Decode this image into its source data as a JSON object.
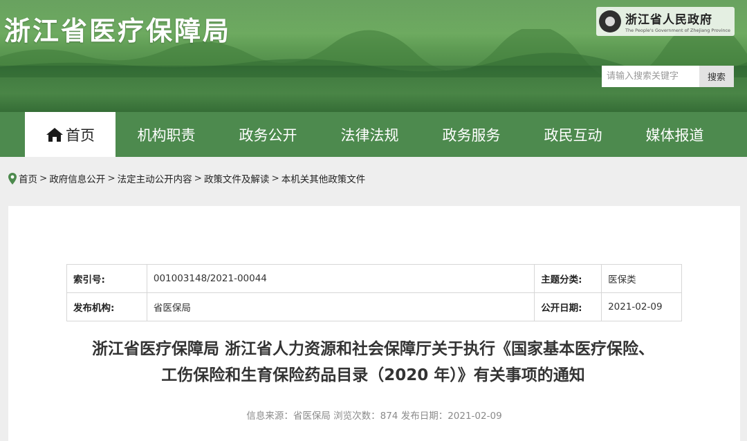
{
  "header": {
    "site_title": "浙江省医疗保障局",
    "gov_name_cn": "浙江省人民政府",
    "gov_name_en": "The People's Government of Zhejiang Province",
    "search_placeholder": "请输入搜索关键字",
    "search_button": "搜索"
  },
  "nav": {
    "items": [
      {
        "label": "首页",
        "active": true
      },
      {
        "label": "机构职责"
      },
      {
        "label": "政务公开"
      },
      {
        "label": "法律法规"
      },
      {
        "label": "政务服务"
      },
      {
        "label": "政民互动"
      },
      {
        "label": "媒体报道"
      }
    ]
  },
  "breadcrumb": {
    "items": [
      "首页",
      "政府信息公开",
      "法定主动公开内容",
      "政策文件及解读",
      "本机关其他政策文件"
    ],
    "separator": ">"
  },
  "meta": {
    "index_no_label": "索引号:",
    "index_no": "001003148/2021-00044",
    "category_label": "主题分类:",
    "category": "医保类",
    "publisher_label": "发布机构:",
    "publisher": "省医保局",
    "date_label": "公开日期:",
    "date": "2021-02-09"
  },
  "document": {
    "title_line1": "浙江省医疗保障局 浙江省人力资源和社会保障厅关于执行《国家基本医疗保险、",
    "title_line2": "工伤保险和生育保险药品目录（2020 年）》有关事项的通知",
    "source_label": "信息来源：",
    "source": "省医保局",
    "views_label": "浏览次数：",
    "views": "874",
    "publish_label": "发布日期：",
    "publish_date": "2021-02-09"
  },
  "colors": {
    "nav_bg": "#4d8a4e",
    "banner_green": "#5c9a52"
  }
}
